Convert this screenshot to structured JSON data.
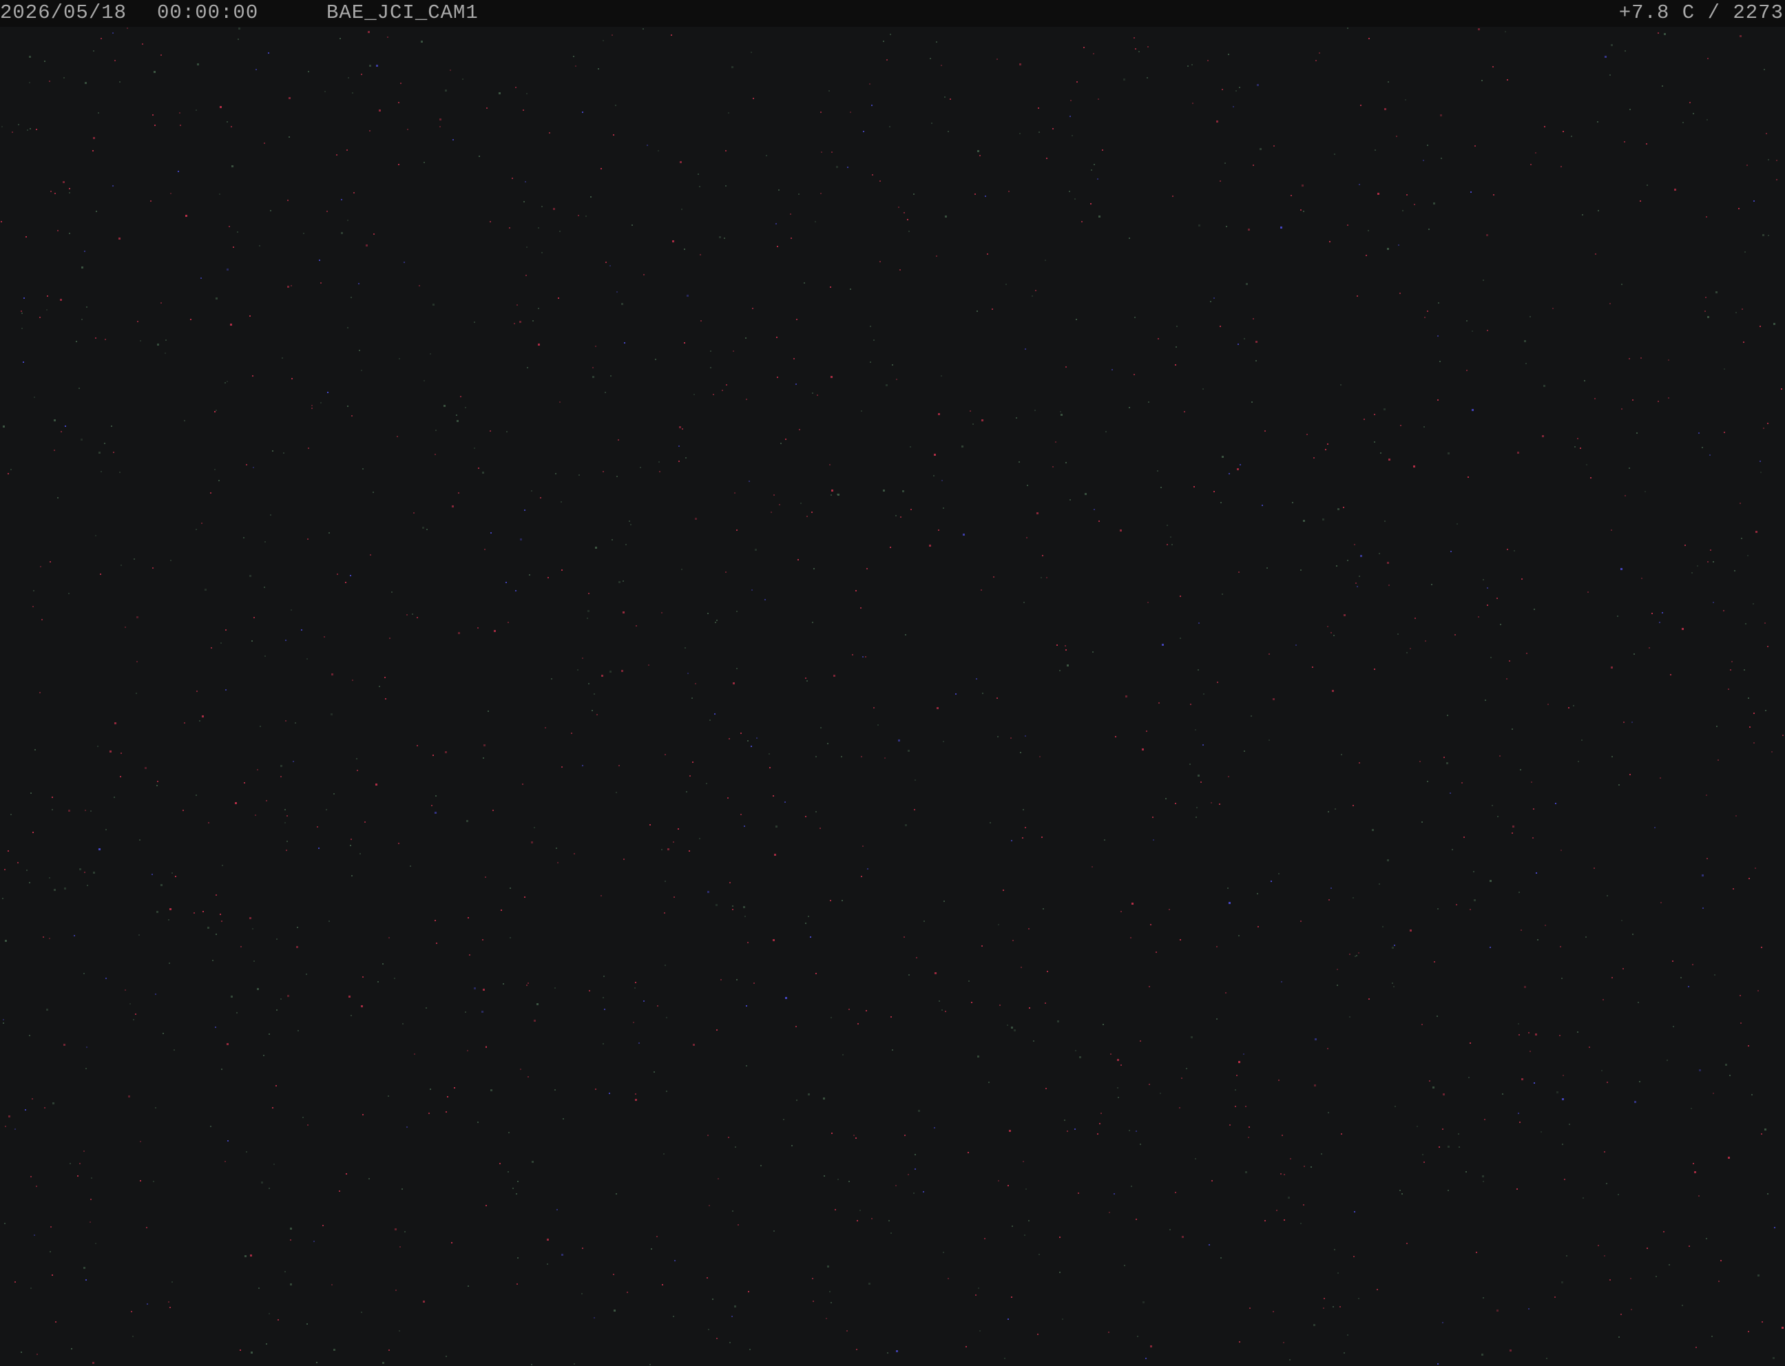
{
  "overlay": {
    "date": "2026/05/18",
    "time": "00:00:00",
    "camera_name": "BAE_JCI_CAM1",
    "temperature_reading": "+7.8 C / 2273"
  },
  "colors": {
    "sky_background": "#131415",
    "overlay_background": "#0d0d0d",
    "overlay_text": "#a9a9a9",
    "hot_pixel_red": "#c0304a",
    "hot_pixel_green": "#3f5a45",
    "hot_pixel_blue": "#4a4ad0"
  }
}
